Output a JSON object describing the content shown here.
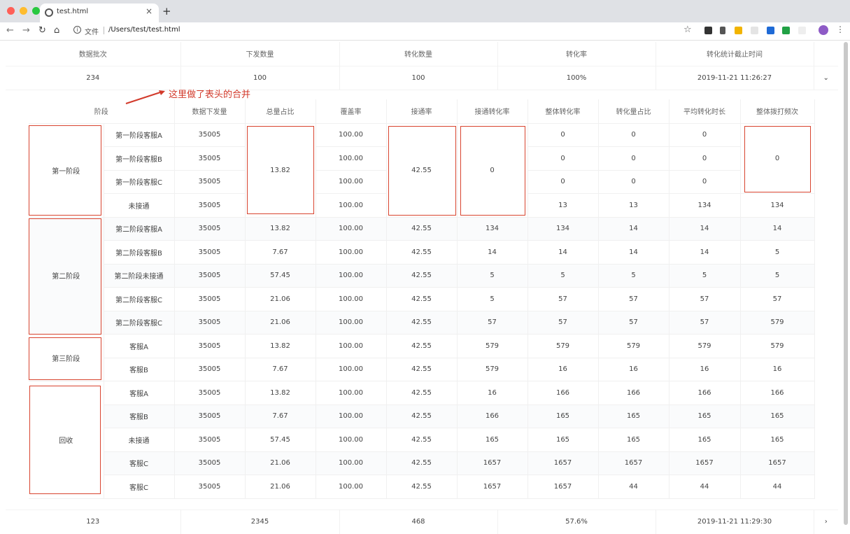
{
  "browser": {
    "tab_title": "test.html",
    "tab_close": "×",
    "new_tab": "+",
    "scheme_label": "文件",
    "url": "/Users/test/test.html",
    "info_icon": "i",
    "back": "←",
    "forward": "→",
    "reload": "↻",
    "home": "⌂",
    "star": "☆",
    "menu": "⋮"
  },
  "summary": {
    "headers": [
      "数据批次",
      "下发数量",
      "转化数量",
      "转化率",
      "转化统计截止时间"
    ],
    "row": [
      "234",
      "100",
      "100",
      "100%",
      "2019-11-21 11:26:27"
    ],
    "expand_icon": "⌄"
  },
  "annotation": "这里做了表头的合并",
  "table": {
    "headers": [
      "阶段",
      "数据下发量",
      "总量占比",
      "覆盖率",
      "接通率",
      "接通转化率",
      "整体转化率",
      "转化量占比",
      "平均转化时长",
      "整体拨打频次"
    ],
    "groups": [
      "第一阶段",
      "第二阶段",
      "第三阶段",
      "回收"
    ],
    "rows": [
      [
        "第一阶段客服A",
        "35005",
        "13.82",
        "100.00",
        "42.55",
        "0",
        "0",
        "0",
        "0",
        "0"
      ],
      [
        "第一阶段客服B",
        "35005",
        "",
        "100.00",
        "",
        "",
        "0",
        "0",
        "0",
        ""
      ],
      [
        "第一阶段客服C",
        "35005",
        "",
        "100.00",
        "",
        "",
        "0",
        "0",
        "0",
        ""
      ],
      [
        "未接通",
        "35005",
        "",
        "100.00",
        "",
        "",
        "13",
        "13",
        "134",
        "134"
      ],
      [
        "第二阶段客服A",
        "35005",
        "13.82",
        "100.00",
        "42.55",
        "134",
        "134",
        "14",
        "14",
        "14"
      ],
      [
        "第二阶段客服B",
        "35005",
        "7.67",
        "100.00",
        "42.55",
        "14",
        "14",
        "14",
        "14",
        "5"
      ],
      [
        "第二阶段未接通",
        "35005",
        "57.45",
        "100.00",
        "42.55",
        "5",
        "5",
        "5",
        "5",
        "5"
      ],
      [
        "第二阶段客服C",
        "35005",
        "21.06",
        "100.00",
        "42.55",
        "5",
        "57",
        "57",
        "57",
        "57"
      ],
      [
        "第二阶段客服C",
        "35005",
        "21.06",
        "100.00",
        "42.55",
        "57",
        "57",
        "57",
        "57",
        "579"
      ],
      [
        "客服A",
        "35005",
        "13.82",
        "100.00",
        "42.55",
        "579",
        "579",
        "579",
        "579",
        "579"
      ],
      [
        "客服B",
        "35005",
        "7.67",
        "100.00",
        "42.55",
        "579",
        "16",
        "16",
        "16",
        "16"
      ],
      [
        "客服A",
        "35005",
        "13.82",
        "100.00",
        "42.55",
        "16",
        "166",
        "166",
        "166",
        "166"
      ],
      [
        "客服B",
        "35005",
        "7.67",
        "100.00",
        "42.55",
        "166",
        "165",
        "165",
        "165",
        "165"
      ],
      [
        "未接通",
        "35005",
        "57.45",
        "100.00",
        "42.55",
        "165",
        "165",
        "165",
        "165",
        "165"
      ],
      [
        "客服C",
        "35005",
        "21.06",
        "100.00",
        "42.55",
        "1657",
        "1657",
        "1657",
        "1657",
        "1657"
      ],
      [
        "客服C",
        "35005",
        "21.06",
        "100.00",
        "42.55",
        "1657",
        "1657",
        "44",
        "44",
        "44"
      ]
    ]
  },
  "footer": {
    "row": [
      "123",
      "2345",
      "468",
      "57.6%",
      "2019-11-21 11:29:30"
    ],
    "expand_icon": "›"
  },
  "colors": {
    "highlight": "#d8442f",
    "annotation": "#d23a2b"
  }
}
